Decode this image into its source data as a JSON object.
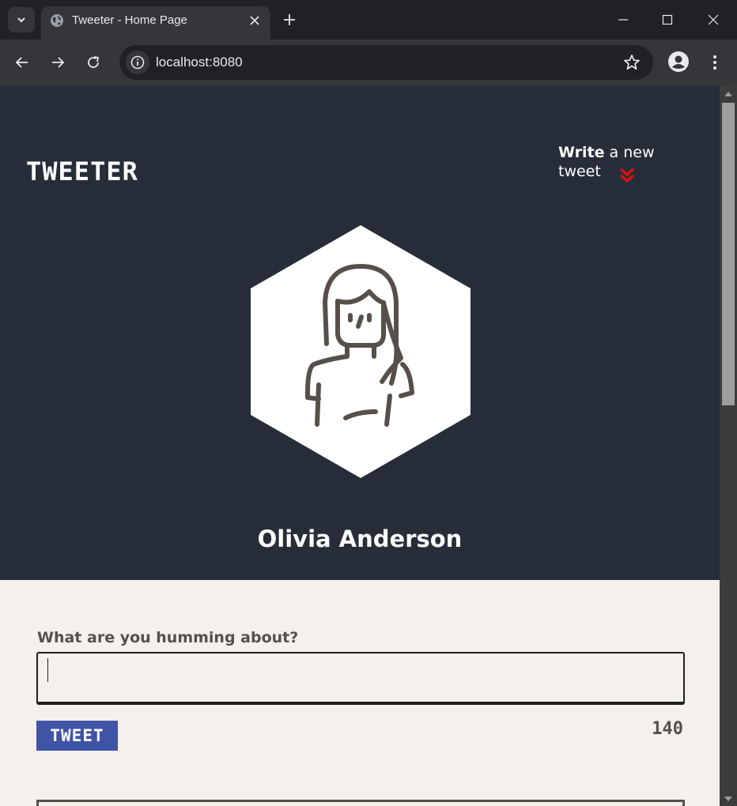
{
  "browser": {
    "tab_title": "Tweeter - Home Page",
    "url": "localhost:8080"
  },
  "page": {
    "brand": "TWEETER",
    "write_link": {
      "strong": "Write",
      "rest": " a new tweet"
    },
    "user_name": "Olivia Anderson",
    "compose": {
      "label": "What are you humming about?",
      "value": "",
      "button_label": "TWEET",
      "counter": "140"
    }
  },
  "colors": {
    "hero_bg": "#262d38",
    "page_bg": "#f4f1ec",
    "accent_red": "#e01010",
    "button_blue": "#4054a6",
    "text_brown": "#555049"
  },
  "icons": [
    "chevron-down-icon",
    "globe-icon",
    "close-icon",
    "plus-icon",
    "minimize-icon",
    "maximize-icon",
    "back-icon",
    "forward-icon",
    "reload-icon",
    "info-icon",
    "star-icon",
    "profile-icon",
    "more-vert-icon",
    "double-chevron-down-icon"
  ]
}
